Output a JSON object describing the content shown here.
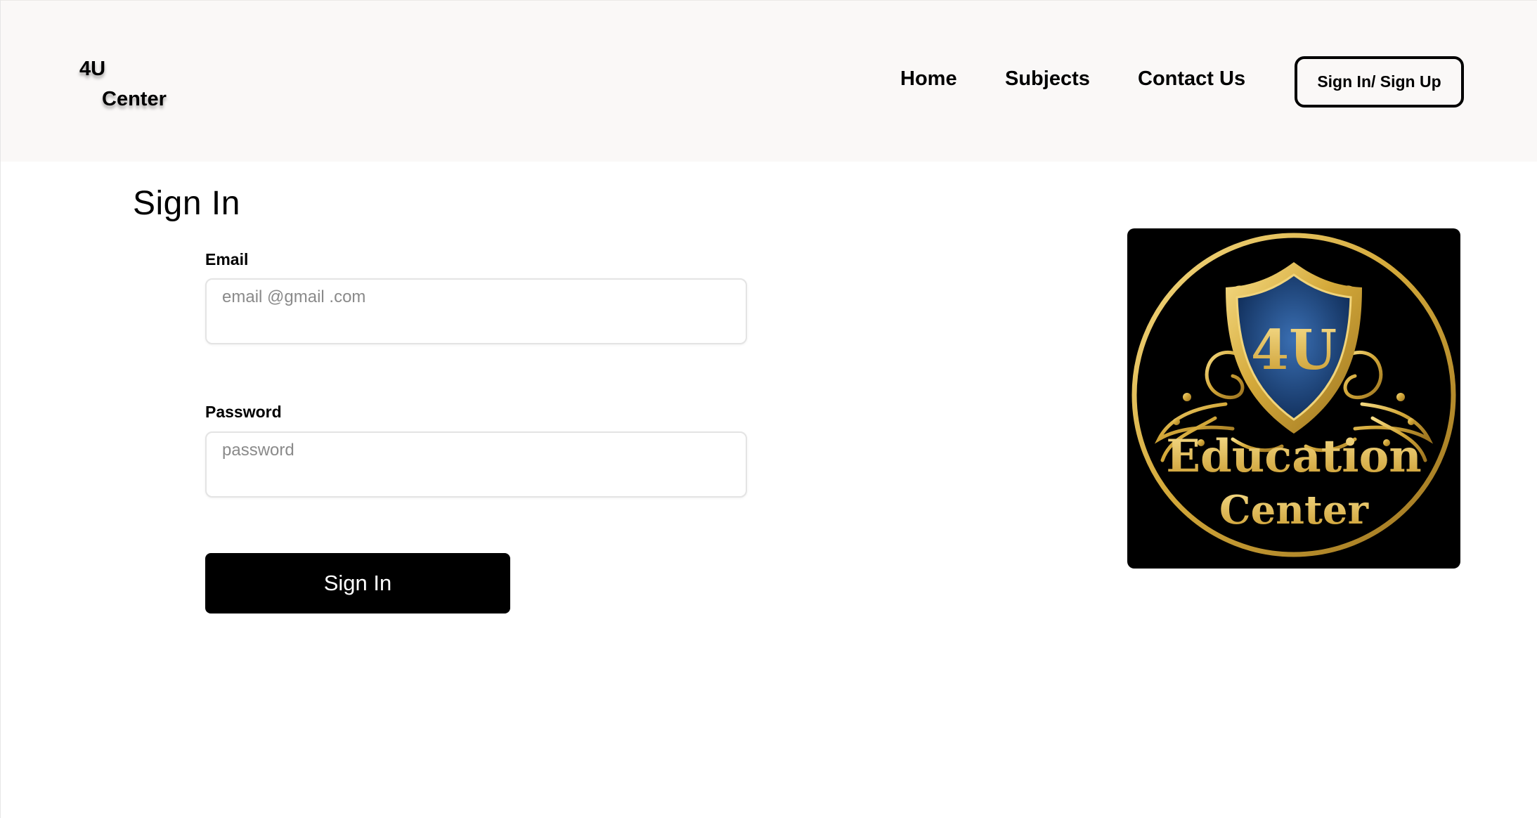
{
  "brand": {
    "line1": "4U",
    "line2": "Center"
  },
  "nav": {
    "home": "Home",
    "subjects": "Subjects",
    "contact": "Contact Us",
    "auth_button": "Sign In/ Sign Up"
  },
  "form": {
    "title": "Sign In",
    "email_label": "Email",
    "email_placeholder": "email @gmail .com",
    "password_label": "Password",
    "password_placeholder": "password",
    "submit_label": "Sign In"
  },
  "emblem": {
    "monogram": "4U",
    "word1": "Education",
    "word2": "Center",
    "colors": {
      "gold": "#d4a93a",
      "gold_light": "#f3d77a",
      "shield_blue": "#1f4f8f",
      "background": "#000000"
    }
  }
}
